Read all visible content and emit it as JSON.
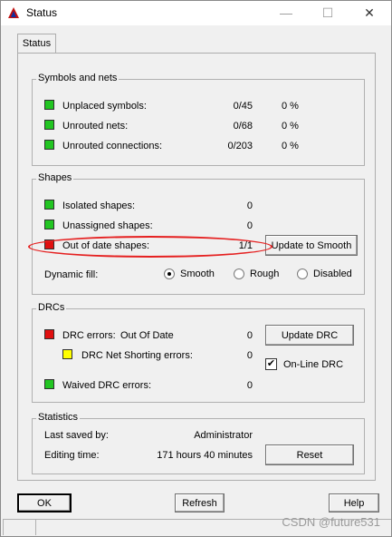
{
  "window": {
    "title": "Status",
    "min": "—",
    "max": "☐",
    "close": "✕",
    "icon": "app-logo-icon"
  },
  "tab": {
    "label": "Status"
  },
  "symbols": {
    "title": "Symbols and nets",
    "rows": [
      {
        "label": "Unplaced symbols:",
        "count": "0/45",
        "pct": "0 %",
        "status": "green"
      },
      {
        "label": "Unrouted nets:",
        "count": "0/68",
        "pct": "0 %",
        "status": "green"
      },
      {
        "label": "Unrouted connections:",
        "count": "0/203",
        "pct": "0 %",
        "status": "green"
      }
    ]
  },
  "shapes": {
    "title": "Shapes",
    "rows": [
      {
        "label": "Isolated shapes:",
        "count": "0",
        "status": "green"
      },
      {
        "label": "Unassigned shapes:",
        "count": "0",
        "status": "green"
      },
      {
        "label": "Out of date shapes:",
        "count": "1/1",
        "status": "red"
      }
    ],
    "update_button": "Update to Smooth",
    "dynamic_fill_label": "Dynamic fill:",
    "fill_options": [
      "Smooth",
      "Rough",
      "Disabled"
    ],
    "fill_selected": "Smooth"
  },
  "drcs": {
    "title": "DRCs",
    "drc_errors_label": "DRC errors:",
    "drc_errors_status_text": "Out Of Date",
    "drc_errors_count": "0",
    "net_shorting_label": "DRC Net Shorting errors:",
    "net_shorting_count": "0",
    "waived_label": "Waived DRC errors:",
    "waived_count": "0",
    "update_button": "Update DRC",
    "online_label": "On-Line DRC",
    "online_checked": "✔"
  },
  "statistics": {
    "title": "Statistics",
    "last_saved_label": "Last saved by:",
    "last_saved_value": "Administrator",
    "editing_label": "Editing time:",
    "editing_value": "171 hours 40 minutes",
    "reset_button": "Reset"
  },
  "footer": {
    "ok": "OK",
    "refresh": "Refresh",
    "help": "Help"
  },
  "watermark": "CSDN @future531",
  "colors": {
    "green": "#22c522",
    "red": "#e01010",
    "yellow": "#ffff00",
    "annotation": "#e52020"
  }
}
